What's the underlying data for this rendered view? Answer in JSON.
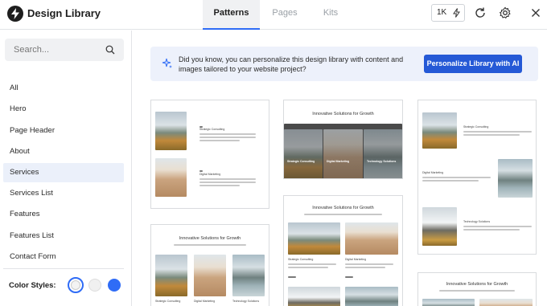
{
  "app": {
    "title": "Design Library"
  },
  "tabs": [
    {
      "label": "Patterns",
      "active": true
    },
    {
      "label": "Pages",
      "active": false
    },
    {
      "label": "Kits",
      "active": false
    }
  ],
  "toolbar": {
    "count_label": "1K",
    "icons": [
      "bolt-icon",
      "refresh-icon",
      "gear-icon",
      "close-icon"
    ]
  },
  "sidebar": {
    "search_placeholder": "Search...",
    "categories": [
      {
        "label": "All",
        "selected": false
      },
      {
        "label": "Hero",
        "selected": false
      },
      {
        "label": "Page Header",
        "selected": false
      },
      {
        "label": "About",
        "selected": false
      },
      {
        "label": "Services",
        "selected": true
      },
      {
        "label": "Services List",
        "selected": false
      },
      {
        "label": "Features",
        "selected": false
      },
      {
        "label": "Features List",
        "selected": false
      },
      {
        "label": "Contact Form",
        "selected": false
      }
    ],
    "color_styles_label": "Color Styles:",
    "color_swatches": [
      "#f3f3f3",
      "#f0f0f0",
      "#2f6cf6"
    ]
  },
  "banner": {
    "text": "Did you know, you can personalize this design library with content and images tailored to your website project?",
    "button_label": "Personalize Library with AI"
  },
  "previews": {
    "growth_title": "Innovative Solutions for Growth",
    "captions": {
      "strategic": "Strategic Consulting",
      "digital": "Digital Marketing",
      "technology": "Technology Solutions"
    }
  },
  "colors": {
    "accent": "#2f6cf6",
    "button": "#2559d6",
    "banner_bg": "#edf1fb"
  }
}
